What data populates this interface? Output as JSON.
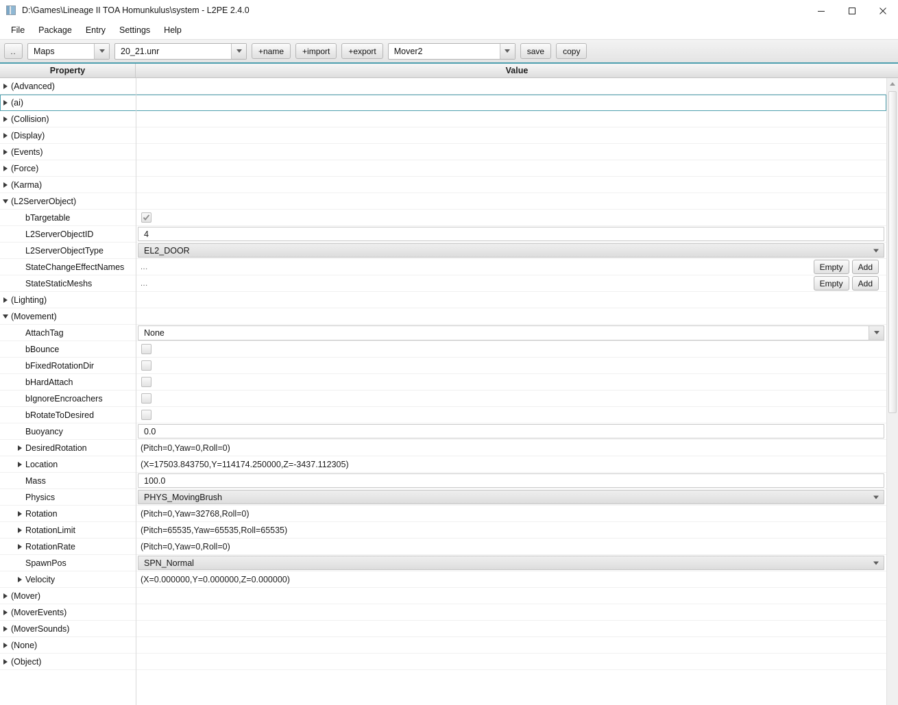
{
  "window": {
    "title": "D:\\Games\\Lineage II TOA Homunkulus\\system - L2PE 2.4.0",
    "icon": "app-icon",
    "controls": {
      "minimize": "minimize-icon",
      "maximize": "maximize-icon",
      "close": "close-icon"
    }
  },
  "menubar": {
    "items": [
      {
        "label": "File"
      },
      {
        "label": "Package"
      },
      {
        "label": "Entry"
      },
      {
        "label": "Settings"
      },
      {
        "label": "Help"
      }
    ]
  },
  "toolbar": {
    "up_button": "..",
    "package_type": "Maps",
    "package_file": "20_21.unr",
    "add_name": "+name",
    "add_import": "+import",
    "add_export": "+export",
    "entry": "Mover2",
    "save": "save",
    "copy": "copy"
  },
  "columns": {
    "property": "Property",
    "value": "Value"
  },
  "accent_color": "#4d9fae",
  "rows": [
    {
      "label": "(Advanced)",
      "indent": 1,
      "twisty": "right",
      "kind": "none"
    },
    {
      "label": "(ai)",
      "indent": 1,
      "twisty": "right",
      "kind": "none",
      "selected": true
    },
    {
      "label": "(Collision)",
      "indent": 1,
      "twisty": "right",
      "kind": "none"
    },
    {
      "label": "(Display)",
      "indent": 1,
      "twisty": "right",
      "kind": "none"
    },
    {
      "label": "(Events)",
      "indent": 1,
      "twisty": "right",
      "kind": "none"
    },
    {
      "label": "(Force)",
      "indent": 1,
      "twisty": "right",
      "kind": "none"
    },
    {
      "label": "(Karma)",
      "indent": 1,
      "twisty": "right",
      "kind": "none"
    },
    {
      "label": "(L2ServerObject)",
      "indent": 1,
      "twisty": "down",
      "kind": "none"
    },
    {
      "label": "bTargetable",
      "indent": 2,
      "twisty": "none",
      "kind": "checkbox",
      "checked": true
    },
    {
      "label": "L2ServerObjectID",
      "indent": 2,
      "twisty": "none",
      "kind": "input",
      "value": "4"
    },
    {
      "label": "L2ServerObjectType",
      "indent": 2,
      "twisty": "none",
      "kind": "combo",
      "value": "EL2_DOOR"
    },
    {
      "label": "StateChangeEffectNames",
      "indent": 2,
      "twisty": "none",
      "kind": "array",
      "value": "...",
      "empty_label": "Empty",
      "add_label": "Add"
    },
    {
      "label": "StateStaticMeshs",
      "indent": 2,
      "twisty": "none",
      "kind": "array",
      "value": "...",
      "empty_label": "Empty",
      "add_label": "Add"
    },
    {
      "label": "(Lighting)",
      "indent": 1,
      "twisty": "right",
      "kind": "none"
    },
    {
      "label": "(Movement)",
      "indent": 1,
      "twisty": "down",
      "kind": "none"
    },
    {
      "label": "AttachTag",
      "indent": 2,
      "twisty": "none",
      "kind": "attach",
      "value": "None"
    },
    {
      "label": "bBounce",
      "indent": 2,
      "twisty": "none",
      "kind": "checkbox",
      "checked": false
    },
    {
      "label": "bFixedRotationDir",
      "indent": 2,
      "twisty": "none",
      "kind": "checkbox",
      "checked": false
    },
    {
      "label": "bHardAttach",
      "indent": 2,
      "twisty": "none",
      "kind": "checkbox",
      "checked": false
    },
    {
      "label": "bIgnoreEncroachers",
      "indent": 2,
      "twisty": "none",
      "kind": "checkbox",
      "checked": false
    },
    {
      "label": "bRotateToDesired",
      "indent": 2,
      "twisty": "none",
      "kind": "checkbox",
      "checked": false
    },
    {
      "label": "Buoyancy",
      "indent": 2,
      "twisty": "none",
      "kind": "input",
      "value": "0.0"
    },
    {
      "label": "DesiredRotation",
      "indent": 2,
      "twisty": "right",
      "kind": "text",
      "value": "(Pitch=0,Yaw=0,Roll=0)"
    },
    {
      "label": "Location",
      "indent": 2,
      "twisty": "right",
      "kind": "text",
      "value": "(X=17503.843750,Y=114174.250000,Z=-3437.112305)"
    },
    {
      "label": "Mass",
      "indent": 2,
      "twisty": "none",
      "kind": "input",
      "value": "100.0"
    },
    {
      "label": "Physics",
      "indent": 2,
      "twisty": "none",
      "kind": "combo",
      "value": "PHYS_MovingBrush"
    },
    {
      "label": "Rotation",
      "indent": 2,
      "twisty": "right",
      "kind": "text",
      "value": "(Pitch=0,Yaw=32768,Roll=0)"
    },
    {
      "label": "RotationLimit",
      "indent": 2,
      "twisty": "right",
      "kind": "text",
      "value": "(Pitch=65535,Yaw=65535,Roll=65535)"
    },
    {
      "label": "RotationRate",
      "indent": 2,
      "twisty": "right",
      "kind": "text",
      "value": "(Pitch=0,Yaw=0,Roll=0)"
    },
    {
      "label": "SpawnPos",
      "indent": 2,
      "twisty": "none",
      "kind": "combo",
      "value": "SPN_Normal"
    },
    {
      "label": "Velocity",
      "indent": 2,
      "twisty": "right",
      "kind": "text",
      "value": "(X=0.000000,Y=0.000000,Z=0.000000)"
    },
    {
      "label": "(Mover)",
      "indent": 1,
      "twisty": "right",
      "kind": "none"
    },
    {
      "label": "(MoverEvents)",
      "indent": 1,
      "twisty": "right",
      "kind": "none"
    },
    {
      "label": "(MoverSounds)",
      "indent": 1,
      "twisty": "right",
      "kind": "none"
    },
    {
      "label": "(None)",
      "indent": 1,
      "twisty": "right",
      "kind": "none"
    },
    {
      "label": "(Object)",
      "indent": 1,
      "twisty": "right",
      "kind": "none"
    }
  ],
  "scrollbar": {
    "up_arrow": "scroll-up-icon"
  }
}
